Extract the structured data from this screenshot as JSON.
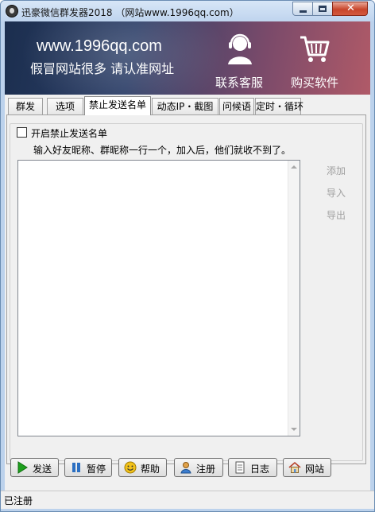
{
  "window": {
    "title": "迅豪微信群发器2018 （网站www.1996qq.com）"
  },
  "banner": {
    "url": "www.1996qq.com",
    "slogan": "假冒网站很多 请认准网址",
    "support_label": "联系客服",
    "buy_label": "购买软件"
  },
  "tabs": [
    {
      "label": "群发"
    },
    {
      "label": "选项"
    },
    {
      "label": "禁止发送名单"
    },
    {
      "label": "动态IP・截图"
    },
    {
      "label": "问候语"
    },
    {
      "label": "定时・循环"
    }
  ],
  "panel": {
    "enable_label": "开启禁止发送名单",
    "enable_checked": false,
    "instruction": "输入好友昵称、群昵称一行一个，加入后，他们就收不到了。",
    "side_buttons": {
      "add": "添加",
      "import": "导入",
      "export": "导出"
    }
  },
  "buttons": {
    "send": "发送",
    "pause": "暂停",
    "help": "帮助",
    "register": "注册",
    "log": "日志",
    "website": "网站"
  },
  "status": {
    "text": "已注册"
  },
  "colors": {
    "banner_dark": "#1b2e4e",
    "banner_warm": "#b05a68",
    "accent_green": "#1ea01e"
  }
}
